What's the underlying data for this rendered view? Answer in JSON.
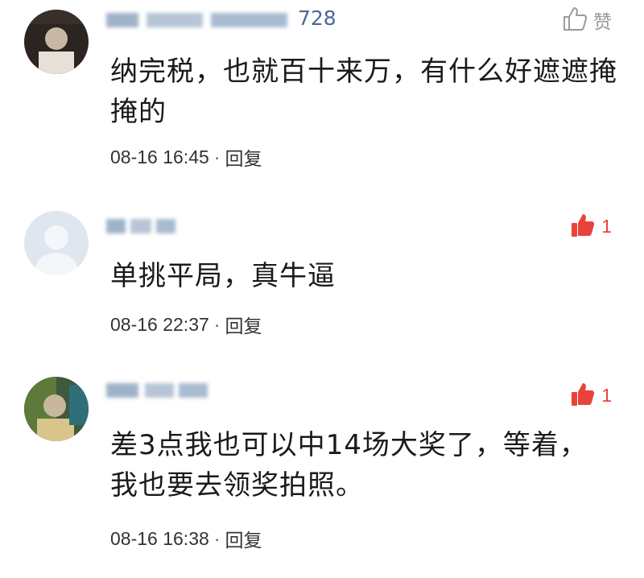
{
  "comments": [
    {
      "username_visible": "728",
      "text": "纳完税，也就百十来万，有什么好遮遮掩掩的",
      "time": "08-16 16:45",
      "separator": "·",
      "reply_label": "回复",
      "like_count": "",
      "like_label": "赞",
      "liked": false
    },
    {
      "username_visible": "",
      "text": "单挑平局，真牛逼",
      "time": "08-16 22:37",
      "separator": "·",
      "reply_label": "回复",
      "like_count": "1",
      "like_label": "",
      "liked": true
    },
    {
      "username_visible": "",
      "text": "差3点我也可以中14场大奖了，等着，我也要去领奖拍照。",
      "time": "08-16 16:38",
      "separator": "·",
      "reply_label": "回复",
      "like_count": "1",
      "like_label": "",
      "liked": true
    }
  ],
  "colors": {
    "like_active": "#e8433a",
    "like_inactive": "#9a9a9a",
    "username": "#4a6a92"
  }
}
